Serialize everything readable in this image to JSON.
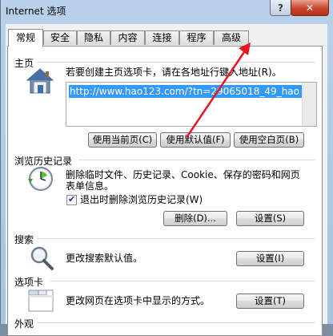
{
  "window": {
    "title": "Internet 选项",
    "help_label": "?",
    "close_label": "✕"
  },
  "tabs": [
    {
      "label": "常规"
    },
    {
      "label": "安全"
    },
    {
      "label": "隐私"
    },
    {
      "label": "内容"
    },
    {
      "label": "连接"
    },
    {
      "label": "程序"
    },
    {
      "label": "高级"
    }
  ],
  "home": {
    "title": "主页",
    "description": "若要创建主页选项卡，请在各地址行键入地址(R)。",
    "url": "http://www.hao123.com/?tn=29065018_49_hao",
    "btn_current": "使用当前页(C)",
    "btn_default": "使用默认值(F)",
    "btn_blank": "使用空白页(B)"
  },
  "history": {
    "title": "浏览历史记录",
    "description_line1": "删除临时文件、历史记录、Cookie、保存的密码和网页",
    "description_line2": "表单信息。",
    "checkbox_label": "退出时删除浏览历史记录(W)",
    "checkbox_checked": true,
    "btn_delete": "删除(D)...",
    "btn_settings": "设置(S)"
  },
  "search": {
    "title": "搜索",
    "description": "更改搜索默认值。",
    "btn_settings": "设置(I)"
  },
  "tabs_section": {
    "title": "选项卡",
    "description": "更改网页在选项卡中显示的方式。",
    "btn_settings": "设置(T)"
  },
  "appearance": {
    "title": "外观"
  },
  "annotation": {
    "arrow_color": "#e8141e"
  }
}
